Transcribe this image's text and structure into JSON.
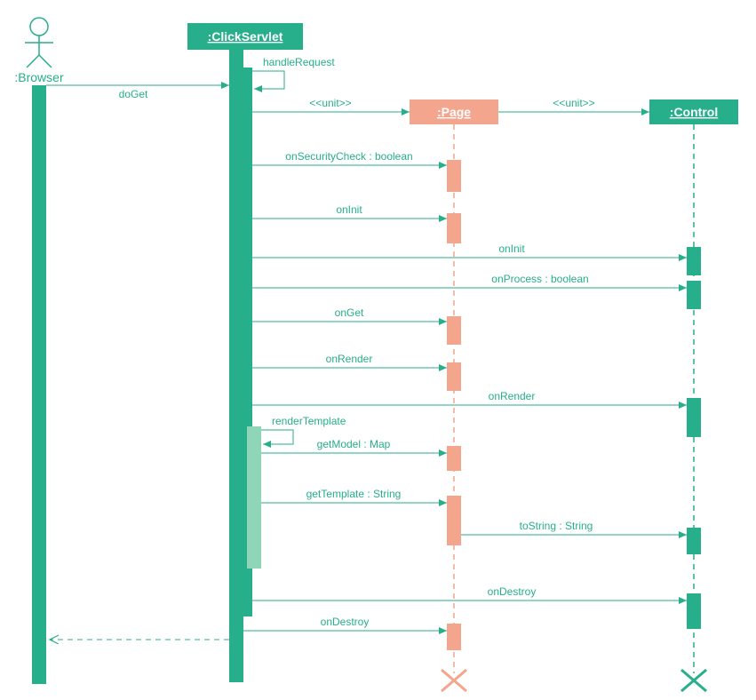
{
  "actors": {
    "browser": ":Browser",
    "clickServlet": ":ClickServlet",
    "page": ":Page",
    "control": ":Control"
  },
  "messages": {
    "doGet": "doGet",
    "handleRequest": "handleRequest",
    "unit1": "<<unit>>",
    "unit2": "<<unit>>",
    "onSecurityCheck": "onSecurityCheck : boolean",
    "onInit": "onInit",
    "onInitCtrl": "onInit",
    "onProcess": "onProcess : boolean",
    "onGet": "onGet",
    "onRender": "onRender",
    "onRenderCtrl": "onRender",
    "renderTemplate": "renderTemplate",
    "getModel": "getModel : Map",
    "getTemplate": "getTemplate : String",
    "toString": "toString : String",
    "onDestroyCtrl": "onDestroy",
    "onDestroy": "onDestroy"
  }
}
